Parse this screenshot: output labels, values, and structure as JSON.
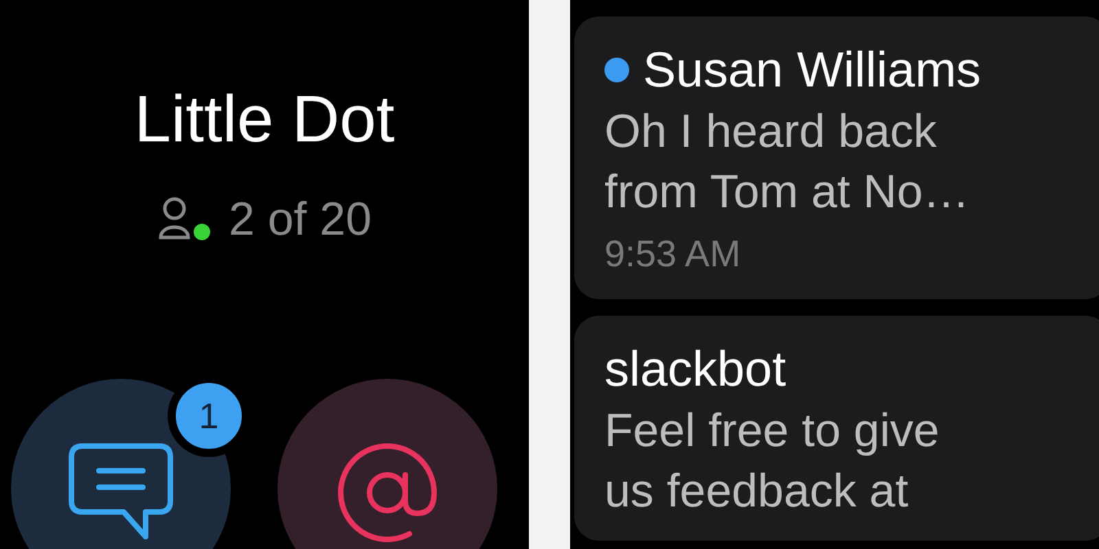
{
  "left_screen": {
    "title": "Little Dot",
    "members": "2 of 20",
    "online": true,
    "actions": [
      {
        "kind": "messages",
        "badge": "1"
      },
      {
        "kind": "mentions"
      }
    ]
  },
  "right_screen": {
    "messages": [
      {
        "sender": "Susan Williams",
        "unread": true,
        "text": "Oh I heard back from Tom at No…",
        "time": "9:53 AM"
      },
      {
        "sender": "slackbot",
        "unread": false,
        "text": "Feel free to give us feedback at"
      }
    ]
  }
}
